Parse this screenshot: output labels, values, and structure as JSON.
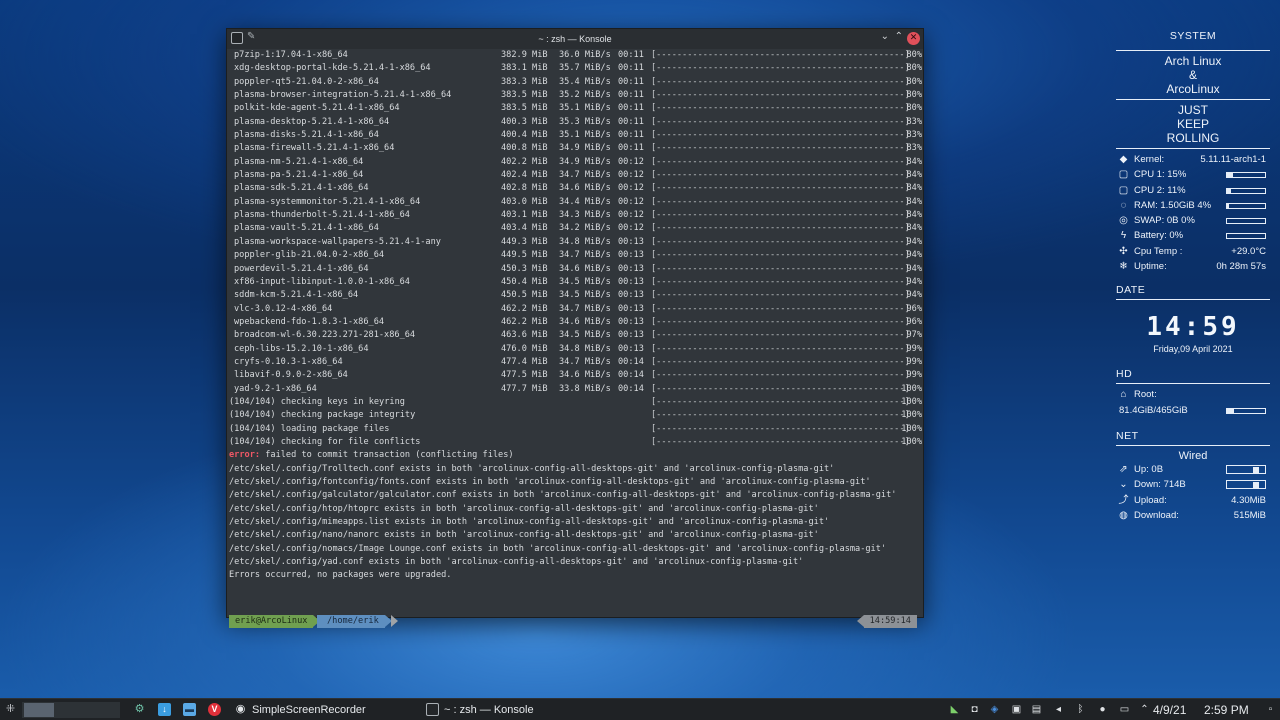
{
  "window": {
    "title": "~ : zsh — Konsole",
    "min_glyph": "⌄",
    "max_glyph": "⌃",
    "close_glyph": "✕",
    "pin_glyph": "✎"
  },
  "terminal": {
    "packages": [
      {
        "name": "p7zip-1:17.04-1-x86_64",
        "size": "382.9 MiB",
        "rate": "36.0 MiB/s",
        "time": "00:11",
        "bar": "[------------------------------------------------]",
        "pct": "80%"
      },
      {
        "name": "xdg-desktop-portal-kde-5.21.4-1-x86_64",
        "size": "383.1 MiB",
        "rate": "35.7 MiB/s",
        "time": "00:11",
        "bar": "[------------------------------------------------]",
        "pct": "80%"
      },
      {
        "name": "poppler-qt5-21.04.0-2-x86_64",
        "size": "383.3 MiB",
        "rate": "35.4 MiB/s",
        "time": "00:11",
        "bar": "[------------------------------------------------]",
        "pct": "80%"
      },
      {
        "name": "plasma-browser-integration-5.21.4-1-x86_64",
        "size": "383.5 MiB",
        "rate": "35.2 MiB/s",
        "time": "00:11",
        "bar": "[------------------------------------------------]",
        "pct": "80%"
      },
      {
        "name": "polkit-kde-agent-5.21.4-1-x86_64",
        "size": "383.5 MiB",
        "rate": "35.1 MiB/s",
        "time": "00:11",
        "bar": "[------------------------------------------------]",
        "pct": "80%"
      },
      {
        "name": "plasma-desktop-5.21.4-1-x86_64",
        "size": "400.3 MiB",
        "rate": "35.3 MiB/s",
        "time": "00:11",
        "bar": "[------------------------------------------------]",
        "pct": "83%"
      },
      {
        "name": "plasma-disks-5.21.4-1-x86_64",
        "size": "400.4 MiB",
        "rate": "35.1 MiB/s",
        "time": "00:11",
        "bar": "[------------------------------------------------]",
        "pct": "83%"
      },
      {
        "name": "plasma-firewall-5.21.4-1-x86_64",
        "size": "400.8 MiB",
        "rate": "34.9 MiB/s",
        "time": "00:11",
        "bar": "[------------------------------------------------]",
        "pct": "83%"
      },
      {
        "name": "plasma-nm-5.21.4-1-x86_64",
        "size": "402.2 MiB",
        "rate": "34.9 MiB/s",
        "time": "00:12",
        "bar": "[------------------------------------------------]",
        "pct": "84%"
      },
      {
        "name": "plasma-pa-5.21.4-1-x86_64",
        "size": "402.4 MiB",
        "rate": "34.7 MiB/s",
        "time": "00:12",
        "bar": "[------------------------------------------------]",
        "pct": "84%"
      },
      {
        "name": "plasma-sdk-5.21.4-1-x86_64",
        "size": "402.8 MiB",
        "rate": "34.6 MiB/s",
        "time": "00:12",
        "bar": "[------------------------------------------------]",
        "pct": "84%"
      },
      {
        "name": "plasma-systemmonitor-5.21.4-1-x86_64",
        "size": "403.0 MiB",
        "rate": "34.4 MiB/s",
        "time": "00:12",
        "bar": "[------------------------------------------------]",
        "pct": "84%"
      },
      {
        "name": "plasma-thunderbolt-5.21.4-1-x86_64",
        "size": "403.1 MiB",
        "rate": "34.3 MiB/s",
        "time": "00:12",
        "bar": "[------------------------------------------------]",
        "pct": "84%"
      },
      {
        "name": "plasma-vault-5.21.4-1-x86_64",
        "size": "403.4 MiB",
        "rate": "34.2 MiB/s",
        "time": "00:12",
        "bar": "[------------------------------------------------]",
        "pct": "84%"
      },
      {
        "name": "plasma-workspace-wallpapers-5.21.4-1-any",
        "size": "449.3 MiB",
        "rate": "34.8 MiB/s",
        "time": "00:13",
        "bar": "[------------------------------------------------]",
        "pct": "94%"
      },
      {
        "name": "poppler-glib-21.04.0-2-x86_64",
        "size": "449.5 MiB",
        "rate": "34.7 MiB/s",
        "time": "00:13",
        "bar": "[------------------------------------------------]",
        "pct": "94%"
      },
      {
        "name": "powerdevil-5.21.4-1-x86_64",
        "size": "450.3 MiB",
        "rate": "34.6 MiB/s",
        "time": "00:13",
        "bar": "[------------------------------------------------]",
        "pct": "94%"
      },
      {
        "name": "xf86-input-libinput-1.0.0-1-x86_64",
        "size": "450.4 MiB",
        "rate": "34.5 MiB/s",
        "time": "00:13",
        "bar": "[------------------------------------------------]",
        "pct": "94%"
      },
      {
        "name": "sddm-kcm-5.21.4-1-x86_64",
        "size": "450.5 MiB",
        "rate": "34.5 MiB/s",
        "time": "00:13",
        "bar": "[------------------------------------------------]",
        "pct": "94%"
      },
      {
        "name": "vlc-3.0.12-4-x86_64",
        "size": "462.2 MiB",
        "rate": "34.7 MiB/s",
        "time": "00:13",
        "bar": "[------------------------------------------------]",
        "pct": "96%"
      },
      {
        "name": "wpebackend-fdo-1.8.3-1-x86_64",
        "size": "462.2 MiB",
        "rate": "34.6 MiB/s",
        "time": "00:13",
        "bar": "[------------------------------------------------]",
        "pct": "96%"
      },
      {
        "name": "broadcom-wl-6.30.223.271-281-x86_64",
        "size": "463.6 MiB",
        "rate": "34.5 MiB/s",
        "time": "00:13",
        "bar": "[------------------------------------------------]",
        "pct": "97%"
      },
      {
        "name": "ceph-libs-15.2.10-1-x86_64",
        "size": "476.0 MiB",
        "rate": "34.8 MiB/s",
        "time": "00:13",
        "bar": "[------------------------------------------------]",
        "pct": "99%"
      },
      {
        "name": "cryfs-0.10.3-1-x86_64",
        "size": "477.4 MiB",
        "rate": "34.7 MiB/s",
        "time": "00:14",
        "bar": "[------------------------------------------------]",
        "pct": "99%"
      },
      {
        "name": "libavif-0.9.0-2-x86_64",
        "size": "477.5 MiB",
        "rate": "34.6 MiB/s",
        "time": "00:14",
        "bar": "[------------------------------------------------]",
        "pct": "99%"
      },
      {
        "name": "yad-9.2-1-x86_64",
        "size": "477.7 MiB",
        "rate": "33.8 MiB/s",
        "time": "00:14",
        "bar": "[------------------------------------------------]",
        "pct": "100%"
      }
    ],
    "steps": [
      {
        "text": "(104/104) checking keys in keyring",
        "bar": "[------------------------------------------------]",
        "pct": "100%"
      },
      {
        "text": "(104/104) checking package integrity",
        "bar": "[------------------------------------------------]",
        "pct": "100%"
      },
      {
        "text": "(104/104) loading package files",
        "bar": "[------------------------------------------------]",
        "pct": "100%"
      },
      {
        "text": "(104/104) checking for file conflicts",
        "bar": "[------------------------------------------------]",
        "pct": "100%"
      }
    ],
    "error_label": "error:",
    "error_message": " failed to commit transaction (conflicting files)",
    "conflicts": [
      "/etc/skel/.config/Trolltech.conf exists in both 'arcolinux-config-all-desktops-git' and 'arcolinux-config-plasma-git'",
      "/etc/skel/.config/fontconfig/fonts.conf exists in both 'arcolinux-config-all-desktops-git' and 'arcolinux-config-plasma-git'",
      "/etc/skel/.config/galculator/galculator.conf exists in both 'arcolinux-config-all-desktops-git' and 'arcolinux-config-plasma-git'",
      "/etc/skel/.config/htop/htoprc exists in both 'arcolinux-config-all-desktops-git' and 'arcolinux-config-plasma-git'",
      "/etc/skel/.config/mimeapps.list exists in both 'arcolinux-config-all-desktops-git' and 'arcolinux-config-plasma-git'",
      "/etc/skel/.config/nano/nanorc exists in both 'arcolinux-config-all-desktops-git' and 'arcolinux-config-plasma-git'",
      "/etc/skel/.config/nomacs/Image Lounge.conf exists in both 'arcolinux-config-all-desktops-git' and 'arcolinux-config-plasma-git'",
      "/etc/skel/.config/yad.conf exists in both 'arcolinux-config-all-desktops-git' and 'arcolinux-config-plasma-git'"
    ],
    "final_message": "Errors occurred, no packages were upgraded.",
    "prompt": {
      "user": "erik@ArcoLinux",
      "path": "/home/erik",
      "time": "14:59:14"
    }
  },
  "conky": {
    "system_title": "SYSTEM",
    "distro_line1": "Arch Linux",
    "distro_amp": "&",
    "distro_line2": "ArcoLinux",
    "motto_1": "JUST",
    "motto_2": "KEEP",
    "motto_3": "ROLLING",
    "kernel_label": "Kernel:",
    "kernel_value": "5.11.11-arch1-1",
    "cpu1_label": "CPU 1: 15%",
    "cpu1_level": 0.15,
    "cpu2_label": "CPU 2: 11%",
    "cpu2_level": 0.11,
    "ram_label": "RAM: 1.50GiB 4%",
    "ram_level": 0.04,
    "swap_label": "SWAP: 0B 0%",
    "swap_level": 0.0,
    "battery_label": "Battery: 0%",
    "battery_level": 0.0,
    "temp_label": "Cpu Temp :",
    "temp_value": "+29.0°C",
    "uptime_label": "Uptime:",
    "uptime_value": "0h 28m 57s",
    "date_title": "DATE",
    "clock": "14:59",
    "date": "Friday,09 April 2021",
    "hd_title": "HD",
    "root_label": "Root:",
    "root_value": "81.4GiB/465GiB",
    "root_level": 0.175,
    "net_title": "NET",
    "net_type": "Wired",
    "up_label": "Up: 0B",
    "down_label": "Down: 714B",
    "upload_label": "Upload:",
    "upload_value": "4.30MiB",
    "download_label": "Download:",
    "download_value": "515MiB"
  },
  "taskbar": {
    "tasks": [
      {
        "label": "SimpleScreenRecorder"
      },
      {
        "label": "~ : zsh — Konsole"
      }
    ],
    "date": "4/9/21",
    "time": "2:59 PM"
  },
  "colors": {
    "terminal_bg": "#31363b",
    "error_red": "#ef5766",
    "prompt_user_bg": "#70a050",
    "prompt_path_bg": "#5e8fc0",
    "taskbar_bg": "#1f2225"
  }
}
